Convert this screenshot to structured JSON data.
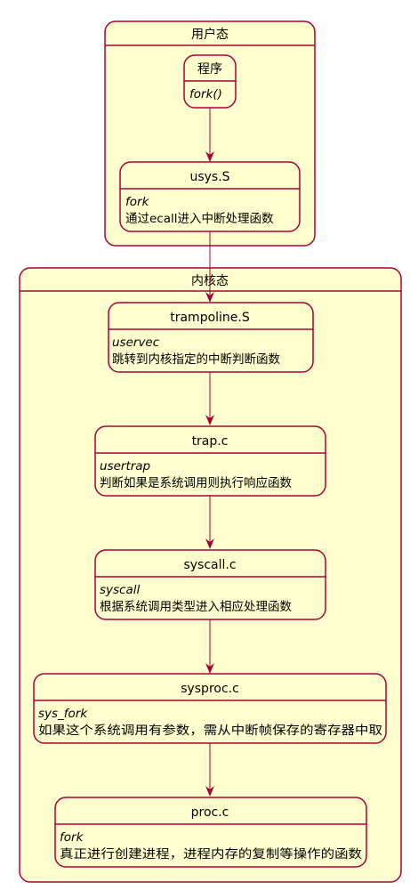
{
  "containers": [
    {
      "id": "user",
      "title": "用户态"
    },
    {
      "id": "kernel",
      "title": "内核态"
    }
  ],
  "nodes": [
    {
      "id": "prog",
      "name": "程序",
      "method": "fork()",
      "desc": ""
    },
    {
      "id": "usys",
      "name": "usys.S",
      "method": "fork",
      "desc": "通过ecall进入中断处理函数"
    },
    {
      "id": "trampoline",
      "name": "trampoline.S",
      "method": "uservec",
      "desc": "跳转到内核指定的中断判断函数"
    },
    {
      "id": "trap",
      "name": "trap.c",
      "method": "usertrap",
      "desc": "判断如果是系统调用则执行响应函数"
    },
    {
      "id": "syscall",
      "name": "syscall.c",
      "method": "syscall",
      "desc": "根据系统调用类型进入相应处理函数"
    },
    {
      "id": "sysproc",
      "name": "sysproc.c",
      "method": "sys_fork",
      "desc": "如果这个系统调用有参数，需从中断帧保存的寄存器中取"
    },
    {
      "id": "proc",
      "name": "proc.c",
      "method": "fork",
      "desc": "真正进行创建进程，进程内存的复制等操作的函数"
    }
  ],
  "edges": [
    {
      "from": "prog",
      "to": "usys"
    },
    {
      "from": "usys",
      "to": "trampoline"
    },
    {
      "from": "trampoline",
      "to": "trap"
    },
    {
      "from": "trap",
      "to": "syscall"
    },
    {
      "from": "syscall",
      "to": "sysproc"
    },
    {
      "from": "sysproc",
      "to": "proc"
    }
  ],
  "colors": {
    "fill": "#FEFECE",
    "stroke": "#A80036",
    "text": "#000000"
  }
}
